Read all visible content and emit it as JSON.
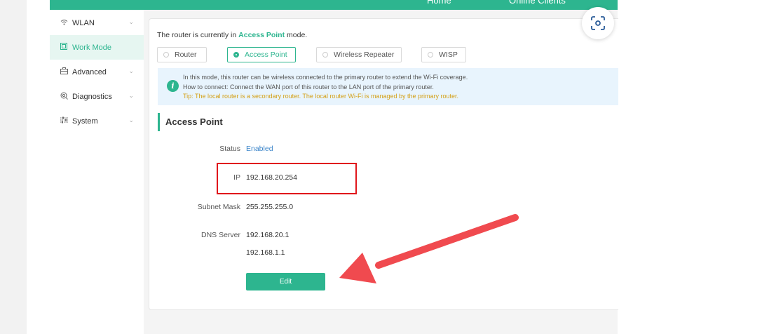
{
  "topbar": {
    "tabs": [
      "Home",
      "Online Clients"
    ]
  },
  "sidebar": {
    "items": [
      {
        "label": "WLAN",
        "icon": "wifi-icon"
      },
      {
        "label": "Work Mode",
        "icon": "work-mode-icon"
      },
      {
        "label": "Advanced",
        "icon": "briefcase-icon"
      },
      {
        "label": "Diagnostics",
        "icon": "diagnostics-icon"
      },
      {
        "label": "System",
        "icon": "sliders-icon"
      }
    ]
  },
  "mode": {
    "prefix": "The router is currently in",
    "current": "Access Point",
    "suffix": "mode.",
    "options": [
      "Router",
      "Access Point",
      "Wireless Repeater",
      "WISP"
    ],
    "selected": "Access Point"
  },
  "info": {
    "line1": "In this mode, this router can be wireless connected to the primary router to extend the Wi-Fi coverage.",
    "line2": "How to connect: Connect the WAN port of this router to the LAN port of the primary router.",
    "tip": "Tip: The local router is a secondary router. The local router Wi-Fi is managed by the primary router."
  },
  "section": {
    "title": "Access Point",
    "status_label": "Status",
    "status_value": "Enabled",
    "ip_label": "IP",
    "ip_value": "192.168.20.254",
    "mask_label": "Subnet Mask",
    "mask_value": "255.255.255.0",
    "dns_label": "DNS Server",
    "dns_primary": "192.168.20.1",
    "dns_secondary": "192.168.1.1",
    "edit_label": "Edit"
  },
  "colors": {
    "accent": "#2db58f",
    "link": "#3a84c9",
    "annotation": "#e0161b",
    "arrow": "#f04a4f",
    "tip": "#d4a017"
  }
}
